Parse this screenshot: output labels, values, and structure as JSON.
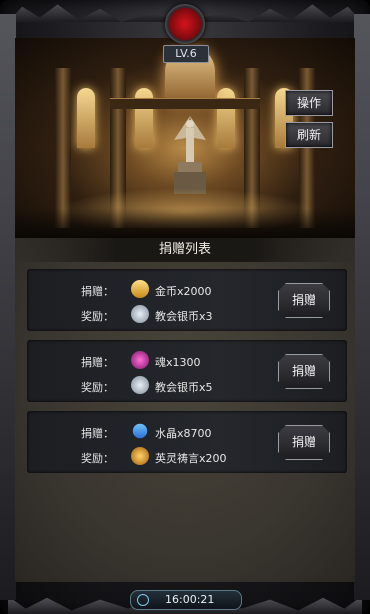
{
  "header": {
    "level": "LV.6"
  },
  "side_buttons": {
    "operate_label": "操作",
    "refresh_label": "刷新"
  },
  "donation_list": {
    "title": "捐赠列表",
    "rows": [
      {
        "donate_label": "捐赠：",
        "donate_item": "金币x2000",
        "donate_icon": "gold-coin-icon",
        "reward_label": "奖励：",
        "reward_item": "教会银币x3",
        "reward_icon": "church-silver-coin-icon",
        "button_label": "捐赠"
      },
      {
        "donate_label": "捐赠：",
        "donate_item": "魂x1300",
        "donate_icon": "soul-icon",
        "reward_label": "奖励：",
        "reward_item": "教会银币x5",
        "reward_icon": "church-silver-coin-icon",
        "button_label": "捐赠"
      },
      {
        "donate_label": "捐赠：",
        "donate_item": "水晶x8700",
        "donate_icon": "crystal-icon",
        "reward_label": "奖励：",
        "reward_item": "英灵祷言x200",
        "reward_icon": "hero-prayer-icon",
        "button_label": "捐赠"
      }
    ]
  },
  "status_bar": {
    "time": "16:00:21"
  }
}
